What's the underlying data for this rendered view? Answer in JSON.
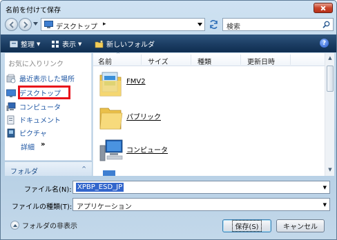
{
  "window": {
    "title": "名前を付けて保存"
  },
  "address": {
    "location": "デスクトップ",
    "chevron": "▸"
  },
  "search": {
    "placeholder": "検索"
  },
  "toolbar": {
    "organize": "整理",
    "view": "表示",
    "new_folder": "新しいフォルダ",
    "help": "?"
  },
  "sidebar": {
    "heading": "お気に入りリンク",
    "items": [
      {
        "label": "最近表示した場所",
        "icon": "recent-places-icon"
      },
      {
        "label": "デスクトップ",
        "icon": "desktop-icon"
      },
      {
        "label": "コンピュータ",
        "icon": "computer-icon"
      },
      {
        "label": "ドキュメント",
        "icon": "documents-icon"
      },
      {
        "label": "ピクチャ",
        "icon": "pictures-icon"
      }
    ],
    "details": "詳細",
    "details_arrows": "»",
    "folders_label": "フォルダ",
    "folders_caret": "^"
  },
  "filelist": {
    "columns": [
      "名前",
      "サイズ",
      "種類",
      "更新日時"
    ],
    "items": [
      {
        "name": "FMV2",
        "icon": "fmv-folder-icon"
      },
      {
        "name": "パブリック",
        "icon": "folder-icon"
      },
      {
        "name": "コンピュータ",
        "icon": "computer-icon"
      }
    ]
  },
  "form": {
    "filename_label": "ファイル名(N):",
    "filename_value": "XPBP_ESD_JP",
    "filetype_label": "ファイルの種類(T):",
    "filetype_value": "アプリケーション",
    "hide_folders": "フォルダの非表示",
    "save_button": "保存(S)",
    "cancel_button": "キャンセル"
  },
  "colors": {
    "toolbar_bg": "#1b3d63",
    "link": "#1e56a3",
    "highlight_border": "#e8101a",
    "selection": "#3366cc"
  }
}
